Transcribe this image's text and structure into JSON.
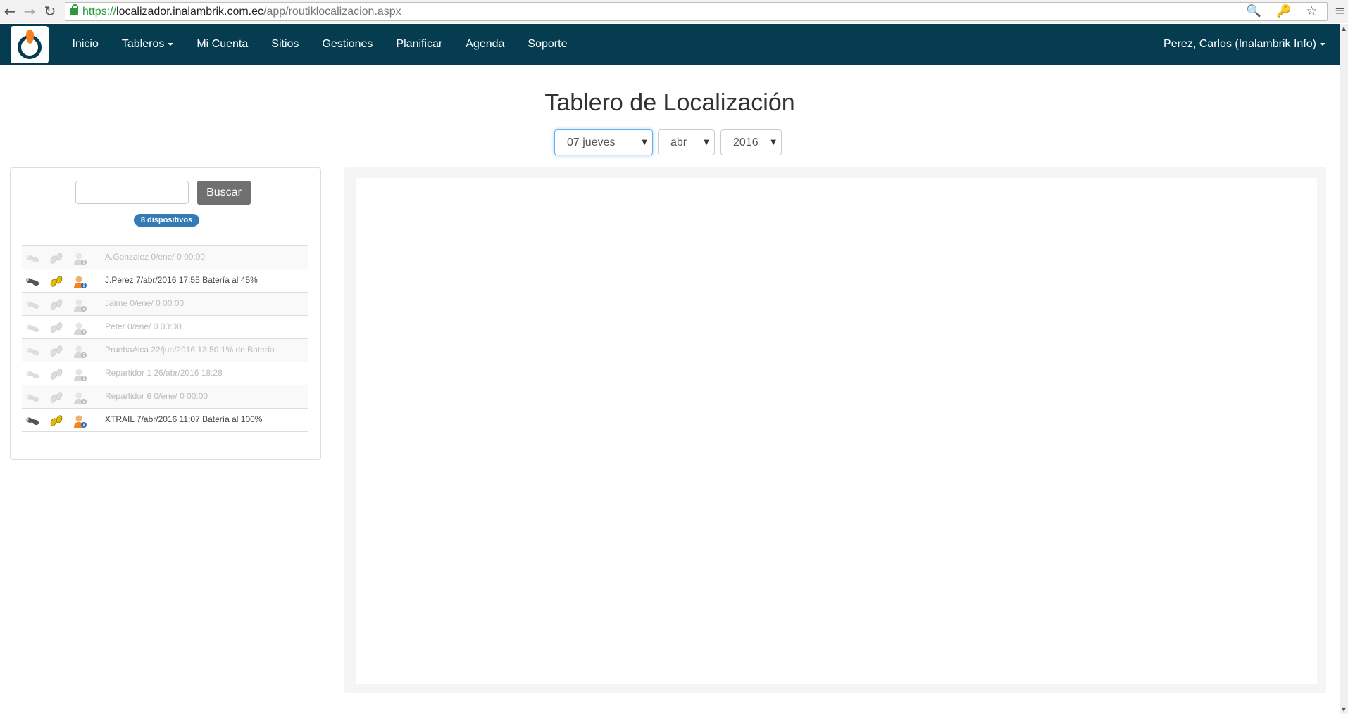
{
  "browser": {
    "url_scheme": "https://",
    "url_host": "localizador.inalambrik.com.ec",
    "url_path": "/app/routiklocalizacion.aspx",
    "back_icon": "←",
    "forward_icon": "→",
    "reload_icon": "↻",
    "url_icons": "🔍 🔑 ☆",
    "menu_icon": "≡"
  },
  "navbar": {
    "items": [
      {
        "label": "Inicio"
      },
      {
        "label": "Tableros",
        "dropdown": true
      },
      {
        "label": "Mi Cuenta"
      },
      {
        "label": "Sitios"
      },
      {
        "label": "Gestiones"
      },
      {
        "label": "Planificar"
      },
      {
        "label": "Agenda"
      },
      {
        "label": "Soporte"
      }
    ],
    "user": "Perez, Carlos (Inalambrik Info)",
    "bg_color": "#053c4f",
    "logo_accent": "#f58220"
  },
  "page": {
    "title": "Tablero de Localización",
    "day_select": "07 jueves",
    "month_select": "abr",
    "year_select": "2016"
  },
  "search": {
    "value": "",
    "button_label": "Buscar",
    "badge": "8 dispositivos"
  },
  "devices": [
    {
      "text": "A.Gonzalez 0/ene/ 0 00:00",
      "active": false
    },
    {
      "text": "J.Perez 7/abr/2016 17:55 Batería al 45%",
      "active": true
    },
    {
      "text": "Jaime 0/ene/ 0 00:00",
      "active": false
    },
    {
      "text": "Peter 0/ene/ 0 00:00",
      "active": false
    },
    {
      "text": "PruebaAlca 22/jun/2016 13:50 1% de Batería",
      "active": false
    },
    {
      "text": "Repartidor 1 26/abr/2016 18:28",
      "active": false
    },
    {
      "text": "Repartidor 6 0/ene/ 0 00:00",
      "active": false
    },
    {
      "text": "XTRAIL 7/abr/2016 11:07 Batería al 100%",
      "active": true
    }
  ]
}
